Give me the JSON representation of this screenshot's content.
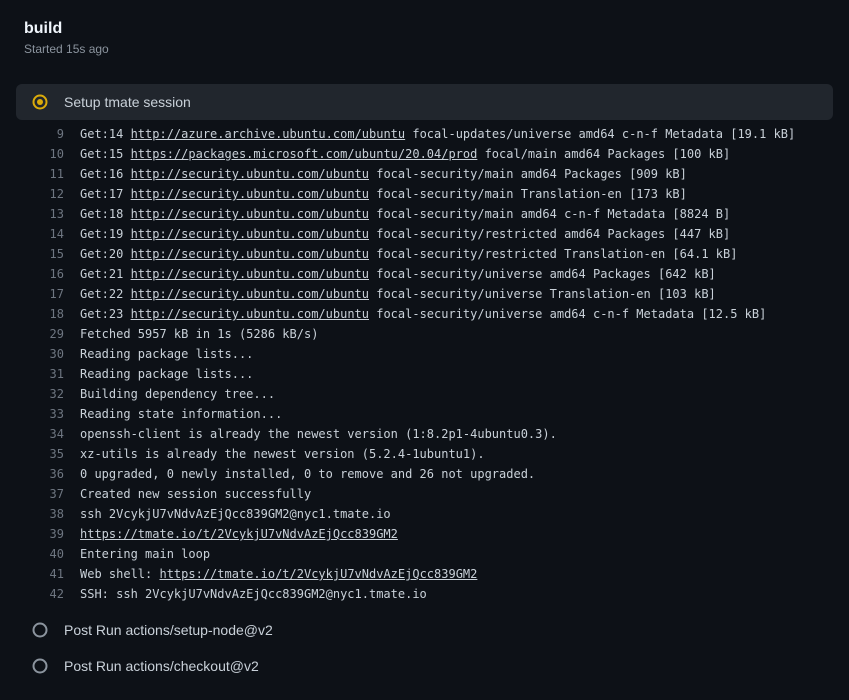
{
  "header": {
    "title": "build",
    "subtitle": "Started 15s ago"
  },
  "activeStep": {
    "label": "Setup tmate session"
  },
  "postSteps": [
    {
      "label": "Post Run actions/setup-node@v2"
    },
    {
      "label": "Post Run actions/checkout@v2"
    }
  ],
  "log": [
    {
      "n": 9,
      "segs": [
        {
          "t": "Get:14 "
        },
        {
          "t": "http://azure.archive.ubuntu.com/ubuntu",
          "link": true
        },
        {
          "t": " focal-updates/universe amd64 c-n-f Metadata [19.1 kB]"
        }
      ]
    },
    {
      "n": 10,
      "segs": [
        {
          "t": "Get:15 "
        },
        {
          "t": "https://packages.microsoft.com/ubuntu/20.04/prod",
          "link": true
        },
        {
          "t": " focal/main amd64 Packages [100 kB]"
        }
      ]
    },
    {
      "n": 11,
      "segs": [
        {
          "t": "Get:16 "
        },
        {
          "t": "http://security.ubuntu.com/ubuntu",
          "link": true
        },
        {
          "t": " focal-security/main amd64 Packages [909 kB]"
        }
      ]
    },
    {
      "n": 12,
      "segs": [
        {
          "t": "Get:17 "
        },
        {
          "t": "http://security.ubuntu.com/ubuntu",
          "link": true
        },
        {
          "t": " focal-security/main Translation-en [173 kB]"
        }
      ]
    },
    {
      "n": 13,
      "segs": [
        {
          "t": "Get:18 "
        },
        {
          "t": "http://security.ubuntu.com/ubuntu",
          "link": true
        },
        {
          "t": " focal-security/main amd64 c-n-f Metadata [8824 B]"
        }
      ]
    },
    {
      "n": 14,
      "segs": [
        {
          "t": "Get:19 "
        },
        {
          "t": "http://security.ubuntu.com/ubuntu",
          "link": true
        },
        {
          "t": " focal-security/restricted amd64 Packages [447 kB]"
        }
      ]
    },
    {
      "n": 15,
      "segs": [
        {
          "t": "Get:20 "
        },
        {
          "t": "http://security.ubuntu.com/ubuntu",
          "link": true
        },
        {
          "t": " focal-security/restricted Translation-en [64.1 kB]"
        }
      ]
    },
    {
      "n": 16,
      "segs": [
        {
          "t": "Get:21 "
        },
        {
          "t": "http://security.ubuntu.com/ubuntu",
          "link": true
        },
        {
          "t": " focal-security/universe amd64 Packages [642 kB]"
        }
      ]
    },
    {
      "n": 17,
      "segs": [
        {
          "t": "Get:22 "
        },
        {
          "t": "http://security.ubuntu.com/ubuntu",
          "link": true
        },
        {
          "t": " focal-security/universe Translation-en [103 kB]"
        }
      ]
    },
    {
      "n": 18,
      "segs": [
        {
          "t": "Get:23 "
        },
        {
          "t": "http://security.ubuntu.com/ubuntu",
          "link": true
        },
        {
          "t": " focal-security/universe amd64 c-n-f Metadata [12.5 kB]"
        }
      ]
    },
    {
      "n": 29,
      "segs": [
        {
          "t": "Fetched 5957 kB in 1s (5286 kB/s)"
        }
      ]
    },
    {
      "n": 30,
      "segs": [
        {
          "t": "Reading package lists..."
        }
      ]
    },
    {
      "n": 31,
      "segs": [
        {
          "t": "Reading package lists..."
        }
      ]
    },
    {
      "n": 32,
      "segs": [
        {
          "t": "Building dependency tree..."
        }
      ]
    },
    {
      "n": 33,
      "segs": [
        {
          "t": "Reading state information..."
        }
      ]
    },
    {
      "n": 34,
      "segs": [
        {
          "t": "openssh-client is already the newest version (1:8.2p1-4ubuntu0.3)."
        }
      ]
    },
    {
      "n": 35,
      "segs": [
        {
          "t": "xz-utils is already the newest version (5.2.4-1ubuntu1)."
        }
      ]
    },
    {
      "n": 36,
      "segs": [
        {
          "t": "0 upgraded, 0 newly installed, 0 to remove and 26 not upgraded."
        }
      ]
    },
    {
      "n": 37,
      "segs": [
        {
          "t": "Created new session successfully"
        }
      ]
    },
    {
      "n": 38,
      "segs": [
        {
          "t": "ssh 2VcykjU7vNdvAzEjQcc839GM2@nyc1.tmate.io"
        }
      ]
    },
    {
      "n": 39,
      "segs": [
        {
          "t": "https://tmate.io/t/2VcykjU7vNdvAzEjQcc839GM2",
          "link": true
        }
      ]
    },
    {
      "n": 40,
      "segs": [
        {
          "t": "Entering main loop"
        }
      ]
    },
    {
      "n": 41,
      "segs": [
        {
          "t": "Web shell: "
        },
        {
          "t": "https://tmate.io/t/2VcykjU7vNdvAzEjQcc839GM2",
          "link": true
        }
      ]
    },
    {
      "n": 42,
      "segs": [
        {
          "t": "SSH: ssh 2VcykjU7vNdvAzEjQcc839GM2@nyc1.tmate.io"
        }
      ]
    }
  ]
}
